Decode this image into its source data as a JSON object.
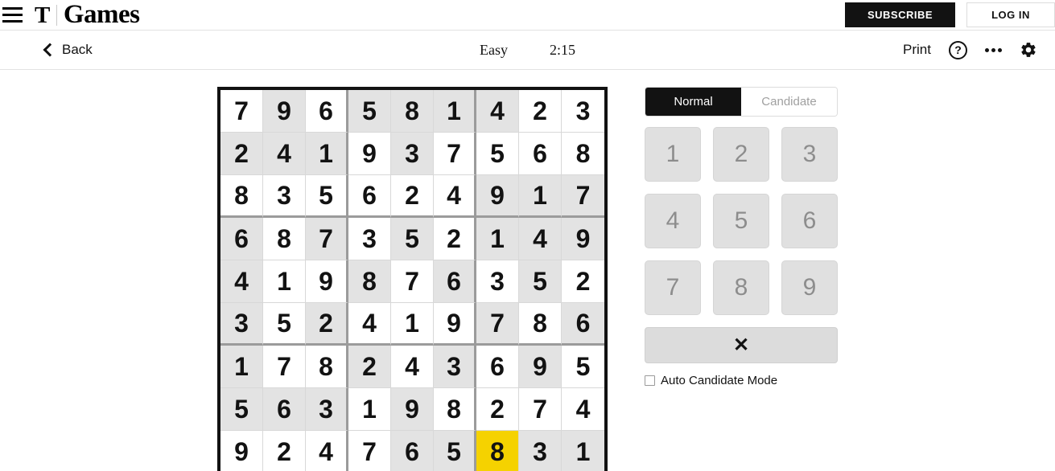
{
  "masthead": {
    "menu_icon": "hamburger-menu-icon",
    "logo_mark": "T",
    "brand": "Games",
    "subscribe_label": "SUBSCRIBE",
    "login_label": "LOG IN"
  },
  "toolbar": {
    "back_label": "Back",
    "back_icon": "chevron-left-icon",
    "difficulty": "Easy",
    "timer": "2:15",
    "print_label": "Print",
    "help_icon": "question-mark-circle-icon",
    "help_glyph": "?",
    "more_icon": "ellipsis-icon",
    "settings_icon": "gear-icon"
  },
  "board": {
    "rows": [
      [
        "7",
        "9",
        "6",
        "5",
        "8",
        "1",
        "4",
        "2",
        "3"
      ],
      [
        "2",
        "4",
        "1",
        "9",
        "3",
        "7",
        "5",
        "6",
        "8"
      ],
      [
        "8",
        "3",
        "5",
        "6",
        "2",
        "4",
        "9",
        "1",
        "7"
      ],
      [
        "6",
        "8",
        "7",
        "3",
        "5",
        "2",
        "1",
        "4",
        "9"
      ],
      [
        "4",
        "1",
        "9",
        "8",
        "7",
        "6",
        "3",
        "5",
        "2"
      ],
      [
        "3",
        "5",
        "2",
        "4",
        "1",
        "9",
        "7",
        "8",
        "6"
      ],
      [
        "1",
        "7",
        "8",
        "2",
        "4",
        "3",
        "6",
        "9",
        "5"
      ],
      [
        "5",
        "6",
        "3",
        "1",
        "9",
        "8",
        "2",
        "7",
        "4"
      ],
      [
        "9",
        "2",
        "4",
        "7",
        "6",
        "5",
        "8",
        "3",
        "1"
      ]
    ],
    "shaded": [
      [
        0,
        1,
        0,
        1,
        1,
        1,
        1,
        0,
        0
      ],
      [
        1,
        1,
        1,
        0,
        1,
        0,
        0,
        0,
        0
      ],
      [
        0,
        0,
        0,
        0,
        0,
        0,
        1,
        1,
        1
      ],
      [
        1,
        0,
        1,
        0,
        1,
        0,
        1,
        1,
        1
      ],
      [
        1,
        0,
        0,
        1,
        0,
        1,
        0,
        1,
        0
      ],
      [
        1,
        0,
        1,
        0,
        0,
        0,
        1,
        0,
        1
      ],
      [
        1,
        0,
        0,
        1,
        0,
        1,
        0,
        1,
        0
      ],
      [
        1,
        1,
        1,
        0,
        1,
        0,
        0,
        0,
        0
      ],
      [
        0,
        0,
        0,
        0,
        1,
        1,
        0,
        1,
        1
      ]
    ],
    "selected": {
      "row": 8,
      "col": 6
    },
    "selected_color": "#f5d200",
    "shaded_color": "#e3e3e3",
    "border_color": "#121212"
  },
  "controls": {
    "modes": [
      {
        "label": "Normal",
        "active": true
      },
      {
        "label": "Candidate",
        "active": false
      }
    ],
    "numbers": [
      "1",
      "2",
      "3",
      "4",
      "5",
      "6",
      "7",
      "8",
      "9"
    ],
    "erase_label": "✕",
    "erase_icon": "x-erase-icon",
    "auto_candidate_label": "Auto Candidate Mode",
    "auto_candidate_checked": false
  }
}
